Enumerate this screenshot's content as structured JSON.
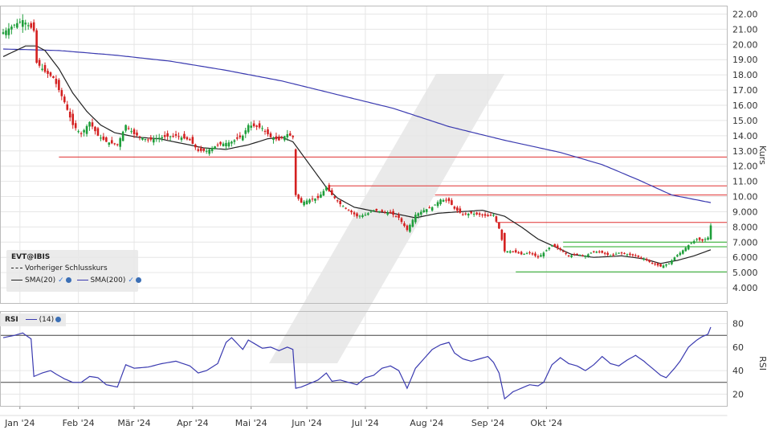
{
  "chart_data": [
    {
      "type": "candlestick",
      "instrument": "EVT@IBIS",
      "ylabel": "Kurs",
      "ylim": [
        3.0,
        22.5
      ],
      "yticks": [
        "4.000",
        "5.000",
        "6.000",
        "7.000",
        "8.000",
        "9.000",
        "10.00",
        "11.00",
        "12.00",
        "13.00",
        "14.00",
        "15.00",
        "16.00",
        "17.00",
        "18.00",
        "19.00",
        "20.00",
        "21.00",
        "22.00"
      ],
      "xticks": [
        "Jan '24",
        "Feb '24",
        "Mär '24",
        "Apr '24",
        "Mai '24",
        "Jun '24",
        "Jul '24",
        "Aug '24",
        "Sep '24",
        "Okt '24"
      ],
      "legend": {
        "title": "EVT@IBIS",
        "items": [
          {
            "label": "Vorheriger Schlusskurs",
            "style": "dashed",
            "color": "#222222"
          },
          {
            "label": "SMA(20)",
            "style": "solid",
            "color": "#222222"
          },
          {
            "label": "SMA(200)",
            "style": "solid",
            "color": "#3a3ab0"
          }
        ]
      },
      "colors": {
        "up": "#1e9e3a",
        "down": "#d42020",
        "sma20": "#222222",
        "sma200": "#3a3ab0",
        "resistance": "#e03030",
        "support": "#22aa22"
      },
      "price_anchors": [
        [
          0,
          20.8
        ],
        [
          4,
          21.3
        ],
        [
          7,
          21.6
        ],
        [
          10,
          21.1
        ],
        [
          11,
          20.9
        ],
        [
          12,
          18.8
        ],
        [
          15,
          18.2
        ],
        [
          18,
          17.8
        ],
        [
          22,
          16.2
        ],
        [
          25,
          14.7
        ],
        [
          28,
          14.1
        ],
        [
          31,
          14.9
        ],
        [
          34,
          14.0
        ],
        [
          37,
          13.6
        ],
        [
          41,
          13.4
        ],
        [
          44,
          14.7
        ],
        [
          47,
          14.1
        ],
        [
          52,
          13.7
        ],
        [
          57,
          13.9
        ],
        [
          62,
          14.0
        ],
        [
          67,
          13.7
        ],
        [
          70,
          13.0
        ],
        [
          73,
          13.0
        ],
        [
          77,
          13.4
        ],
        [
          82,
          13.6
        ],
        [
          86,
          14.0
        ],
        [
          88,
          14.7
        ],
        [
          93,
          14.5
        ],
        [
          96,
          13.9
        ],
        [
          99,
          13.7
        ],
        [
          102,
          14.1
        ],
        [
          104,
          13.9
        ],
        [
          105,
          10.1
        ],
        [
          107,
          9.6
        ],
        [
          110,
          9.8
        ],
        [
          113,
          9.9
        ],
        [
          116,
          10.6
        ],
        [
          118,
          10.1
        ],
        [
          121,
          9.5
        ],
        [
          124,
          9.1
        ],
        [
          127,
          8.7
        ],
        [
          130,
          8.8
        ],
        [
          133,
          9.1
        ],
        [
          136,
          9.0
        ],
        [
          139,
          8.9
        ],
        [
          142,
          8.6
        ],
        [
          145,
          7.8
        ],
        [
          148,
          8.8
        ],
        [
          151,
          9.1
        ],
        [
          154,
          9.3
        ],
        [
          157,
          9.8
        ],
        [
          160,
          9.7
        ],
        [
          162,
          9.2
        ],
        [
          165,
          8.8
        ],
        [
          168,
          8.9
        ],
        [
          171,
          8.8
        ],
        [
          174,
          8.7
        ],
        [
          176,
          8.8
        ],
        [
          178,
          7.9
        ],
        [
          180,
          6.4
        ],
        [
          183,
          6.4
        ],
        [
          186,
          6.2
        ],
        [
          189,
          6.3
        ],
        [
          192,
          6.0
        ],
        [
          194,
          6.3
        ],
        [
          197,
          6.8
        ],
        [
          200,
          6.5
        ],
        [
          203,
          6.1
        ],
        [
          206,
          6.2
        ],
        [
          209,
          6.1
        ],
        [
          212,
          6.4
        ],
        [
          215,
          6.3
        ],
        [
          218,
          6.1
        ],
        [
          221,
          6.3
        ],
        [
          224,
          6.2
        ],
        [
          227,
          6.1
        ],
        [
          230,
          5.9
        ],
        [
          233,
          5.6
        ],
        [
          236,
          5.4
        ],
        [
          239,
          5.6
        ],
        [
          241,
          6.0
        ],
        [
          243,
          6.3
        ],
        [
          246,
          6.8
        ],
        [
          249,
          7.2
        ],
        [
          251,
          7.1
        ],
        [
          253,
          7.3
        ],
        [
          254,
          8.1
        ]
      ],
      "sma20_anchors": [
        [
          0,
          19.2
        ],
        [
          8,
          19.9
        ],
        [
          12,
          19.9
        ],
        [
          15,
          19.6
        ],
        [
          20,
          18.4
        ],
        [
          25,
          16.8
        ],
        [
          30,
          15.6
        ],
        [
          35,
          14.7
        ],
        [
          40,
          14.2
        ],
        [
          48,
          13.9
        ],
        [
          56,
          13.8
        ],
        [
          64,
          13.5
        ],
        [
          72,
          13.2
        ],
        [
          80,
          13.1
        ],
        [
          88,
          13.4
        ],
        [
          95,
          13.8
        ],
        [
          100,
          13.9
        ],
        [
          104,
          13.6
        ],
        [
          108,
          12.6
        ],
        [
          112,
          11.6
        ],
        [
          116,
          10.6
        ],
        [
          120,
          9.9
        ],
        [
          126,
          9.3
        ],
        [
          134,
          9.0
        ],
        [
          140,
          8.9
        ],
        [
          148,
          8.6
        ],
        [
          156,
          8.9
        ],
        [
          164,
          9.0
        ],
        [
          172,
          9.1
        ],
        [
          180,
          8.7
        ],
        [
          186,
          8.0
        ],
        [
          192,
          7.2
        ],
        [
          198,
          6.7
        ],
        [
          204,
          6.2
        ],
        [
          212,
          6.0
        ],
        [
          222,
          6.1
        ],
        [
          230,
          5.9
        ],
        [
          236,
          5.6
        ],
        [
          242,
          5.8
        ],
        [
          248,
          6.1
        ],
        [
          254,
          6.5
        ]
      ],
      "sma200_anchors": [
        [
          0,
          19.7
        ],
        [
          20,
          19.6
        ],
        [
          40,
          19.3
        ],
        [
          60,
          18.9
        ],
        [
          80,
          18.3
        ],
        [
          100,
          17.6
        ],
        [
          120,
          16.7
        ],
        [
          140,
          15.8
        ],
        [
          160,
          14.6
        ],
        [
          180,
          13.7
        ],
        [
          200,
          12.9
        ],
        [
          215,
          12.1
        ],
        [
          228,
          11.1
        ],
        [
          240,
          10.1
        ],
        [
          254,
          9.6
        ]
      ],
      "horizontal_levels": [
        {
          "value": 12.6,
          "color": "#e03030",
          "from": 20,
          "to": 266
        },
        {
          "value": 10.7,
          "color": "#e03030",
          "from": 117,
          "to": 266
        },
        {
          "value": 10.1,
          "color": "#e03030",
          "from": 155,
          "to": 266
        },
        {
          "value": 8.3,
          "color": "#e03030",
          "from": 177,
          "to": 266
        },
        {
          "value": 7.0,
          "color": "#22aa22",
          "from": 201,
          "to": 266
        },
        {
          "value": 6.7,
          "color": "#22aa22",
          "from": 201,
          "to": 266
        },
        {
          "value": 5.05,
          "color": "#22aa22",
          "from": 184,
          "to": 266
        }
      ]
    },
    {
      "type": "line",
      "title": "RSI",
      "series_name": "(14)",
      "ylabel": "RSI",
      "ylim": [
        10,
        90
      ],
      "yticks": [
        "20",
        "40",
        "60",
        "80"
      ],
      "levels": [
        30,
        70
      ],
      "color": "#3a3ab0",
      "rsi_anchors": [
        [
          0,
          68
        ],
        [
          4,
          70
        ],
        [
          7,
          72
        ],
        [
          10,
          67
        ],
        [
          11,
          35
        ],
        [
          14,
          38
        ],
        [
          17,
          40
        ],
        [
          19,
          37
        ],
        [
          22,
          33
        ],
        [
          25,
          30
        ],
        [
          28,
          30
        ],
        [
          31,
          35
        ],
        [
          34,
          34
        ],
        [
          37,
          28
        ],
        [
          41,
          26
        ],
        [
          44,
          45
        ],
        [
          47,
          42
        ],
        [
          52,
          43
        ],
        [
          57,
          46
        ],
        [
          62,
          48
        ],
        [
          67,
          44
        ],
        [
          70,
          38
        ],
        [
          73,
          40
        ],
        [
          77,
          46
        ],
        [
          80,
          64
        ],
        [
          82,
          68
        ],
        [
          86,
          58
        ],
        [
          88,
          66
        ],
        [
          93,
          59
        ],
        [
          96,
          60
        ],
        [
          99,
          57
        ],
        [
          102,
          60
        ],
        [
          104,
          58
        ],
        [
          105,
          25
        ],
        [
          107,
          26
        ],
        [
          110,
          29
        ],
        [
          113,
          32
        ],
        [
          116,
          38
        ],
        [
          118,
          31
        ],
        [
          121,
          32
        ],
        [
          124,
          30
        ],
        [
          127,
          28
        ],
        [
          130,
          34
        ],
        [
          133,
          36
        ],
        [
          136,
          42
        ],
        [
          139,
          44
        ],
        [
          142,
          40
        ],
        [
          145,
          25
        ],
        [
          148,
          42
        ],
        [
          151,
          50
        ],
        [
          154,
          58
        ],
        [
          157,
          62
        ],
        [
          160,
          64
        ],
        [
          162,
          55
        ],
        [
          165,
          50
        ],
        [
          168,
          48
        ],
        [
          171,
          50
        ],
        [
          174,
          52
        ],
        [
          176,
          47
        ],
        [
          178,
          38
        ],
        [
          180,
          16
        ],
        [
          183,
          22
        ],
        [
          186,
          25
        ],
        [
          189,
          28
        ],
        [
          192,
          27
        ],
        [
          194,
          30
        ],
        [
          197,
          45
        ],
        [
          200,
          51
        ],
        [
          203,
          46
        ],
        [
          206,
          44
        ],
        [
          209,
          40
        ],
        [
          212,
          45
        ],
        [
          215,
          52
        ],
        [
          218,
          46
        ],
        [
          221,
          44
        ],
        [
          224,
          49
        ],
        [
          227,
          53
        ],
        [
          230,
          48
        ],
        [
          233,
          42
        ],
        [
          236,
          36
        ],
        [
          238,
          34
        ],
        [
          241,
          42
        ],
        [
          243,
          48
        ],
        [
          246,
          60
        ],
        [
          249,
          66
        ],
        [
          251,
          69
        ],
        [
          253,
          71
        ],
        [
          254,
          77
        ]
      ]
    }
  ],
  "legend_text": {
    "title": "EVT@IBIS",
    "prev_close": "Vorheriger Schlusskurs",
    "sma20": "SMA(20)",
    "sma200": "SMA(200)",
    "check": "✓",
    "rsi_label": "RSI",
    "rsi_period": "(14)"
  }
}
